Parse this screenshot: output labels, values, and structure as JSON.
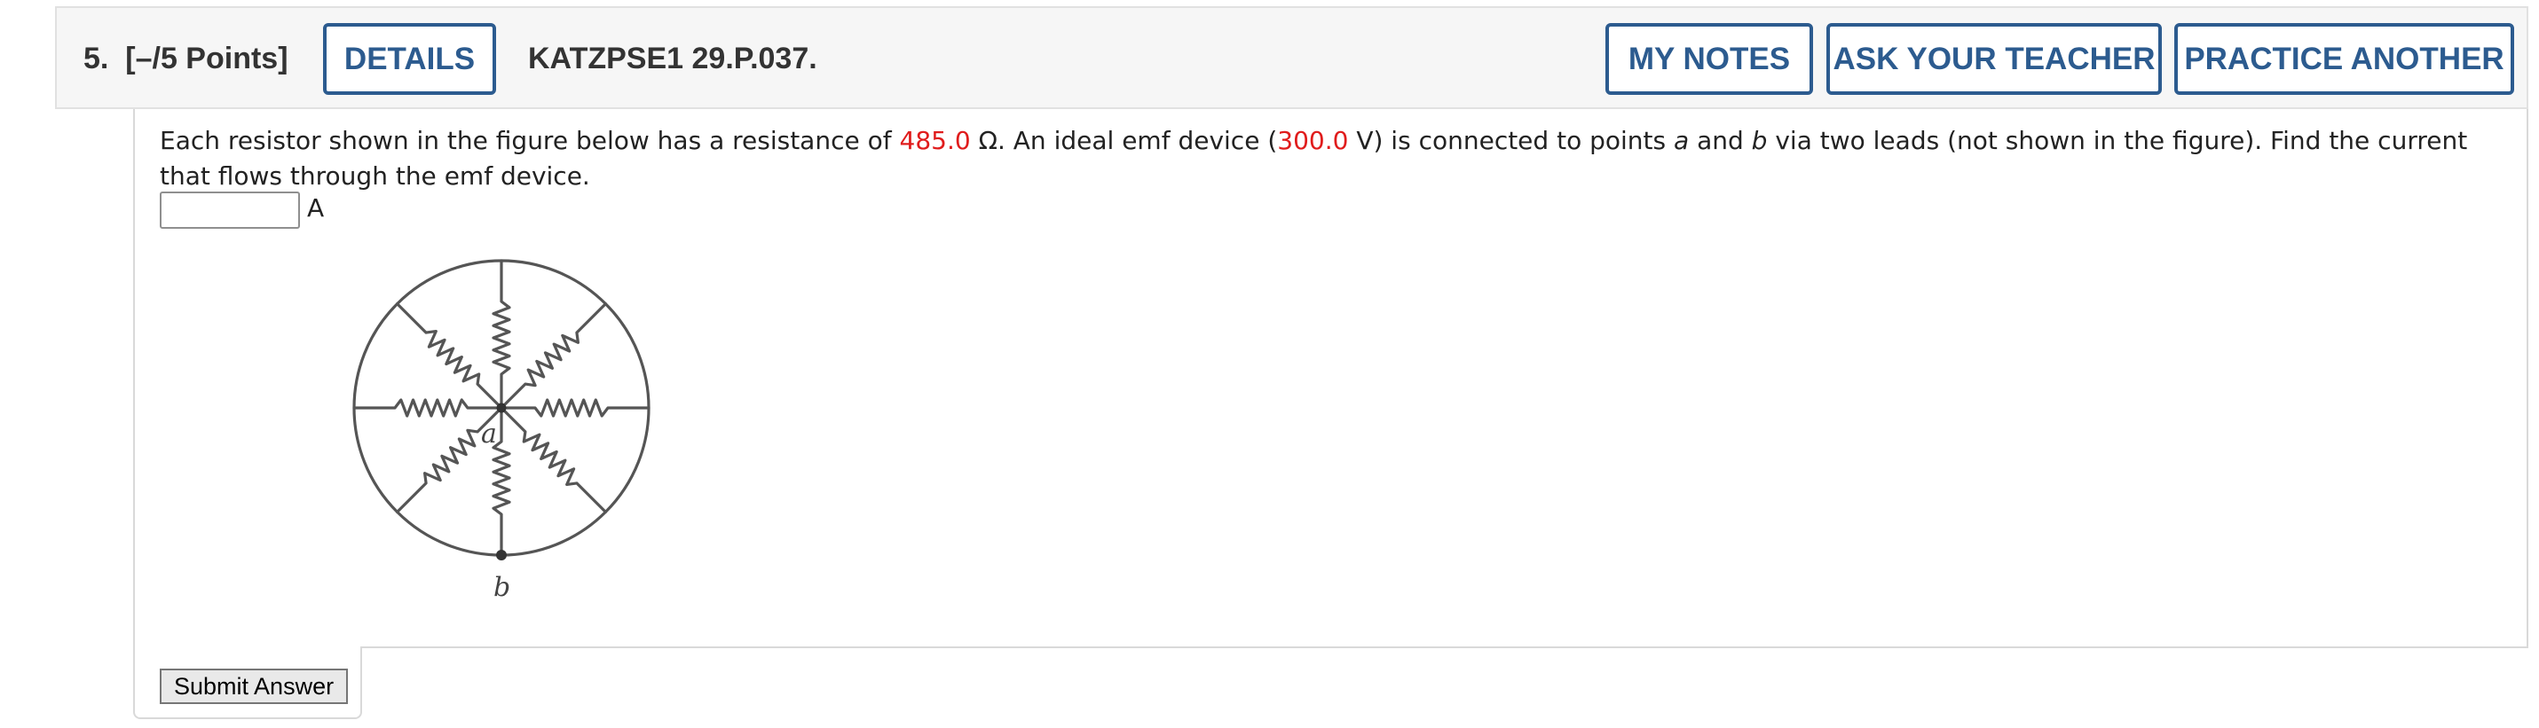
{
  "question": {
    "number_label": "5.",
    "points_label": "[–/5 Points]",
    "code": "KATZPSE1 29.P.037."
  },
  "buttons": {
    "details": "DETAILS",
    "my_notes": "MY NOTES",
    "ask_teacher": "ASK YOUR TEACHER",
    "practice_another": "PRACTICE ANOTHER",
    "submit": "Submit Answer"
  },
  "problem": {
    "text_1": "Each resistor shown in the figure below has a resistance of ",
    "resistance": "485.0",
    "text_2": " Ω. An ideal emf device (",
    "emf": "300.0",
    "text_3": " V) is connected to points ",
    "point_a": "a",
    "text_4": " and ",
    "point_b": "b",
    "text_5": " via two leads (not shown in the figure). Find the current that flows through the emf device."
  },
  "answer": {
    "value": "",
    "placeholder": "",
    "unit": "A"
  },
  "figure": {
    "label_a": "a",
    "label_b": "b"
  },
  "colors": {
    "accent": "#2c5b8f",
    "value_red": "#e01c1c"
  }
}
